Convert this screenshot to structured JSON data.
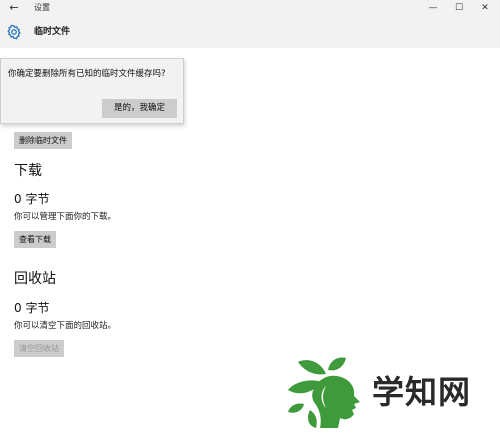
{
  "window": {
    "back_glyph": "←",
    "app_title": "设置",
    "minimize_glyph": "—",
    "maximize_glyph": "☐",
    "close_glyph": "✕"
  },
  "header": {
    "icon": "gear-icon",
    "title": "临时文件"
  },
  "flyout": {
    "message": "你确定要删除所有已知的临时文件缓存吗?",
    "confirm_label": "是的，我确定"
  },
  "temp_files": {
    "delete_button_label": "删除临时文件"
  },
  "downloads": {
    "title": "下载",
    "size": "0 字节",
    "description": "你可以管理下面你的下载。",
    "button_label": "查看下载"
  },
  "recycle_bin": {
    "title": "回收站",
    "size": "0 字节",
    "description": "你可以清空下面的回收站。",
    "button_label": "清空回收站"
  },
  "watermark": {
    "text": "学知网",
    "colors": {
      "leaf_green": "#3f9a3b",
      "text_dark": "#2a2a2a"
    }
  },
  "colors": {
    "titlebar_bg": "#f2f2f2",
    "gear_blue": "#1e6fc0",
    "button_bg": "#cccccc",
    "disabled_text": "#9a9a9a"
  }
}
